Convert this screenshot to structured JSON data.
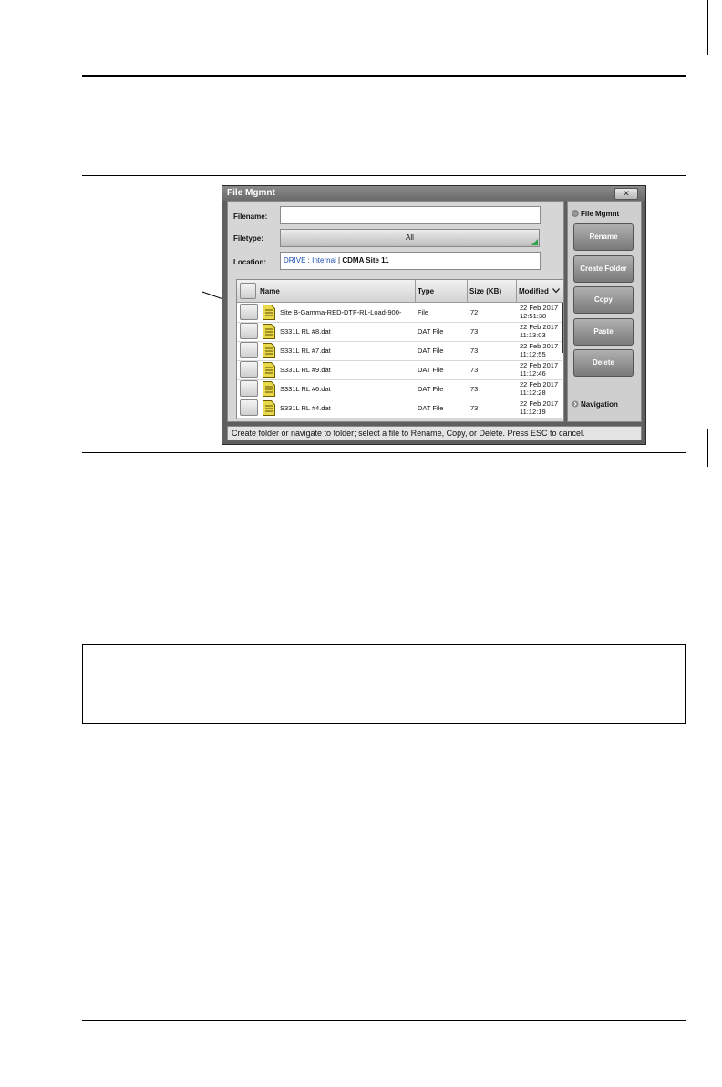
{
  "window": {
    "title": "File Mgmnt",
    "close_glyph": "✕",
    "filename_label": "Filename:",
    "filename_value": "",
    "filetype_label": "Filetype:",
    "filetype_value": "All",
    "location_label": "Location:",
    "location": {
      "drive": "DRIVE",
      "sep1": " : ",
      "internal": "Internal",
      "sep2": " | ",
      "folder": "CDMA Site 11"
    },
    "columns": {
      "name": "Name",
      "type": "Type",
      "size": "Size (KB)",
      "modified": "Modified"
    },
    "sort_icon": "chevron-down-icon",
    "files": [
      {
        "name": "Site B-Gamma-RED-DTF-RL-Load-900-",
        "type": "File",
        "size": "72",
        "date": "22 Feb 2017",
        "time": "12:51:38"
      },
      {
        "name": "S331L RL #8.dat",
        "type": "DAT File",
        "size": "73",
        "date": "22 Feb 2017",
        "time": "11:13:03"
      },
      {
        "name": "S331L RL #7.dat",
        "type": "DAT File",
        "size": "73",
        "date": "22 Feb 2017",
        "time": "11:12:55"
      },
      {
        "name": "S331L RL #9.dat",
        "type": "DAT File",
        "size": "73",
        "date": "22 Feb 2017",
        "time": "11:12:46"
      },
      {
        "name": "S331L RL #6.dat",
        "type": "DAT File",
        "size": "73",
        "date": "22 Feb 2017",
        "time": "11:12:28"
      },
      {
        "name": "S331L RL #4.dat",
        "type": "DAT File",
        "size": "73",
        "date": "22 Feb 2017",
        "time": "11:12:19"
      }
    ],
    "side": {
      "title": "File Mgmnt",
      "buttons": [
        "Rename",
        "Create Folder",
        "Copy",
        "Paste",
        "Delete"
      ],
      "navigation": "Navigation"
    },
    "status": "Create folder or navigate to folder; select a file to Rename, Copy, or Delete. Press ESC to cancel."
  },
  "colors": {
    "window_frame": "#5f5f5f",
    "panel": "#d6d6d6",
    "side_button": "#8a8a8a",
    "link": "#1a4fb5",
    "file_icon": "#e8d84a",
    "filetype_corner": "#2da34a"
  }
}
